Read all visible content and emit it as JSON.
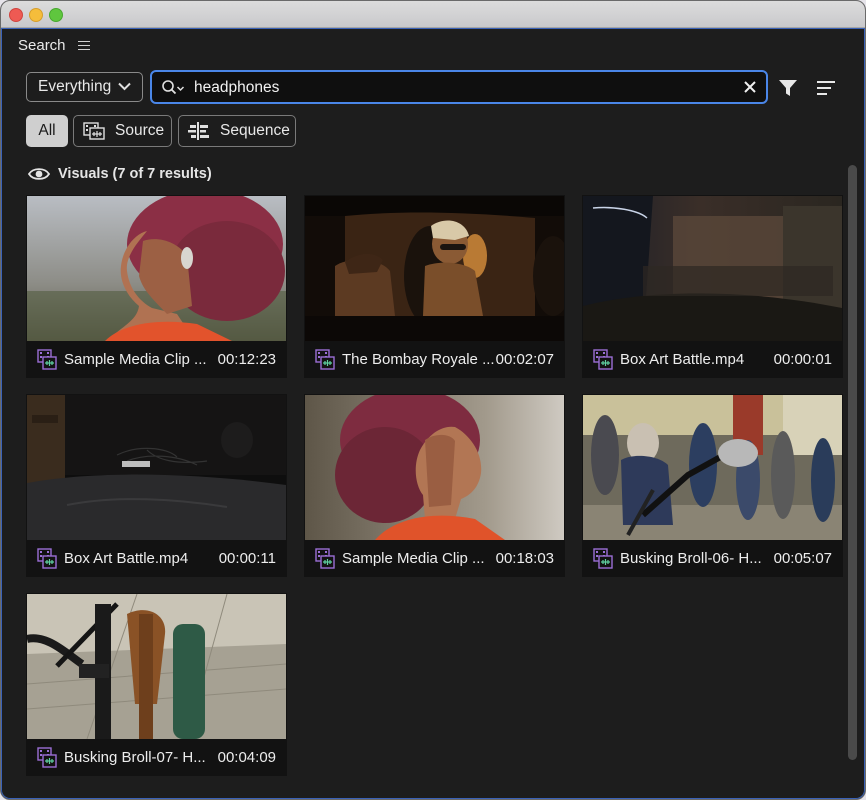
{
  "window": {
    "title": ""
  },
  "panel": {
    "tab_label": "Search"
  },
  "search": {
    "scope": "Everything",
    "query": "headphones"
  },
  "filters": [
    {
      "label": "All",
      "active": true
    },
    {
      "label": "Source",
      "active": false
    },
    {
      "label": "Sequence",
      "active": false
    }
  ],
  "section": {
    "title": "Visuals (7 of 7 results)"
  },
  "results": [
    {
      "name": "Sample Media Clip ...",
      "duration": "00:12:23",
      "thumb": "woman-profile-left"
    },
    {
      "name": "The Bombay Royale ...",
      "duration": "00:02:07",
      "thumb": "car-night-sunglasses"
    },
    {
      "name": "Box Art Battle.mp4",
      "duration": "00:00:01",
      "thumb": "motion-blur-street"
    },
    {
      "name": "Box Art Battle.mp4",
      "duration": "00:00:11",
      "thumb": "dark-floor-cables"
    },
    {
      "name": "Sample Media Clip ...",
      "duration": "00:18:03",
      "thumb": "woman-profile-right"
    },
    {
      "name": "Busking Broll-06- H...",
      "duration": "00:05:07",
      "thumb": "crowd-microphone"
    },
    {
      "name": "Busking Broll-07- H...",
      "duration": "00:04:09",
      "thumb": "guitar-on-stand"
    }
  ],
  "colors": {
    "accent": "#4a86e8",
    "panel_bg": "#1d1d1d",
    "card_bg": "#121212",
    "clip_icon": "#9b6fd6"
  }
}
